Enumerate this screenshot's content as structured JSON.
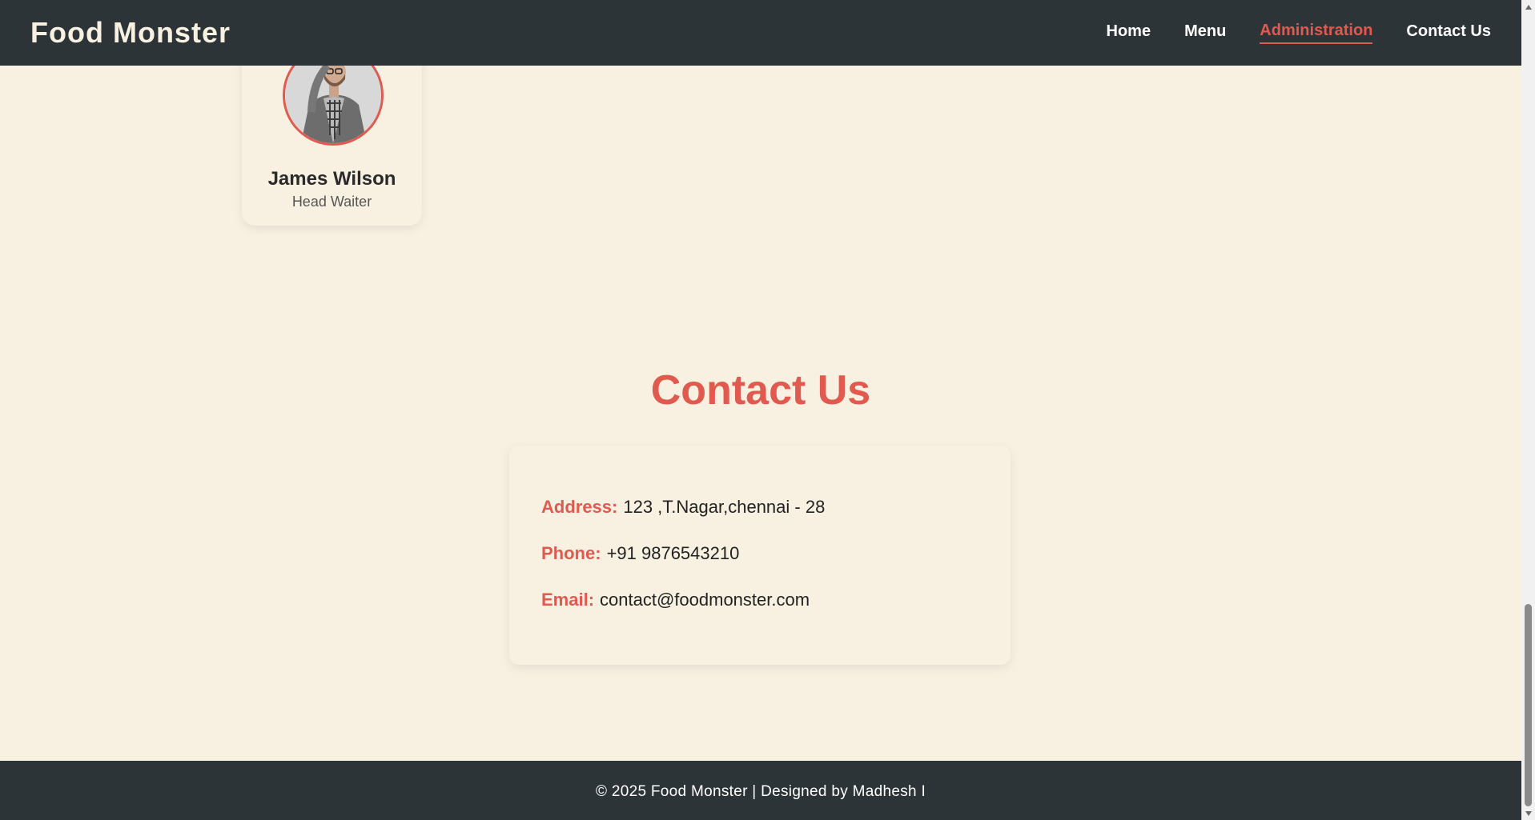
{
  "header": {
    "brand": "Food Monster",
    "nav": [
      {
        "label": "Home",
        "active": false
      },
      {
        "label": "Menu",
        "active": false
      },
      {
        "label": "Administration",
        "active": true
      },
      {
        "label": "Contact Us",
        "active": false
      }
    ]
  },
  "team": {
    "member": {
      "name": "James Wilson",
      "role": "Head Waiter",
      "avatar_icon": "person-avatar-icon"
    }
  },
  "contact": {
    "title": "Contact Us",
    "address_label": "Address:",
    "address_value": "123 ,T.Nagar,chennai - 28",
    "phone_label": "Phone:",
    "phone_value": "+91 9876543210",
    "email_label": "Email:",
    "email_value": "contact@foodmonster.com"
  },
  "footer": {
    "text": "© 2025 Food Monster | Designed by Madhesh I"
  },
  "colors": {
    "background": "#f8f1e2",
    "header_bg": "#2d3438",
    "accent": "#e05a4f"
  }
}
